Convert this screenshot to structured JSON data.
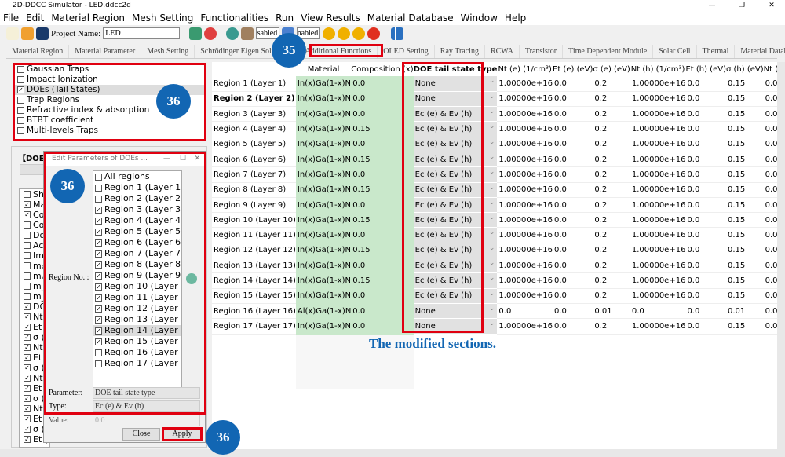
{
  "window": {
    "title": "2D-DDCC Simulator - LED.ddcc2d"
  },
  "menu": [
    "File",
    "Edit",
    "Material Region",
    "Mesh Setting",
    "Functionalities",
    "Run",
    "View Results",
    "Material Database",
    "Window",
    "Help"
  ],
  "toolbar": {
    "project_label": "Project Name:",
    "project_value": "LED",
    "combo1": "Disabled",
    "combo2": "Enabled"
  },
  "tabs": [
    "Material Region",
    "Material Parameter",
    "Mesh Setting",
    "Schrödinger Eigen Solver",
    "",
    "Additional Functions",
    "OLED Setting",
    "Ray Tracing",
    "RCWA",
    "Transistor",
    "Time Dependent Module",
    "Solar Cell",
    "Thermal",
    "Material Database"
  ],
  "active_tab": "Additional Functions",
  "function_list": [
    {
      "label": "Gaussian Traps",
      "checked": false
    },
    {
      "label": "Impact Ionization",
      "checked": false
    },
    {
      "label": "DOEs (Tail States)",
      "checked": true,
      "selected": true
    },
    {
      "label": "Trap Regions",
      "checked": false
    },
    {
      "label": "Refractive index & absorption",
      "checked": false
    },
    {
      "label": "BTBT coefficient",
      "checked": false
    },
    {
      "label": "Multi-levels Traps",
      "checked": false
    }
  ],
  "group_title": "【DOEs",
  "column_list": [
    {
      "l": "Sho",
      "c": false
    },
    {
      "l": "Ma",
      "c": true
    },
    {
      "l": "Cor",
      "c": true
    },
    {
      "l": "Cor",
      "c": false
    },
    {
      "l": "Dop",
      "c": false
    },
    {
      "l": "Act",
      "c": false
    },
    {
      "l": "Imp",
      "c": false
    },
    {
      "l": "mₑ",
      "c": false
    },
    {
      "l": "mₑ.",
      "c": false
    },
    {
      "l": "m_l",
      "c": false
    },
    {
      "l": "m_l",
      "c": false
    },
    {
      "l": "DO",
      "c": true
    },
    {
      "l": "Nt",
      "c": true
    },
    {
      "l": "Et (",
      "c": true
    },
    {
      "l": "σ (e",
      "c": true
    },
    {
      "l": "Nt",
      "c": true
    },
    {
      "l": "Et (",
      "c": true
    },
    {
      "l": "σ (h",
      "c": true
    },
    {
      "l": "Nt",
      "c": true
    },
    {
      "l": "Et (",
      "c": true
    },
    {
      "l": "σ (e",
      "c": true
    },
    {
      "l": "Nt",
      "c": true
    },
    {
      "l": "Et (",
      "c": true
    },
    {
      "l": "σ (h",
      "c": true
    },
    {
      "l": "Et (",
      "c": true
    }
  ],
  "dialog": {
    "title": "Edit Parameters of DOEs ...",
    "region_label": "Region No. :",
    "regions": [
      {
        "l": "All regions",
        "c": false
      },
      {
        "l": "Region 1 (Layer 1) (G",
        "c": false
      },
      {
        "l": "Region 2 (Layer 2) (G",
        "c": false
      },
      {
        "l": "Region 3 (Layer 3) (G",
        "c": true
      },
      {
        "l": "Region 4 (Layer 4) (In",
        "c": true
      },
      {
        "l": "Region 5 (Layer 5) (G",
        "c": true
      },
      {
        "l": "Region 6 (Layer 6) (In",
        "c": true
      },
      {
        "l": "Region 7 (Layer 7) (G",
        "c": true
      },
      {
        "l": "Region 8 (Layer 8) (In",
        "c": true
      },
      {
        "l": "Region 9 (Layer 9) (G",
        "c": true
      },
      {
        "l": "Region 10 (Layer 10)",
        "c": true
      },
      {
        "l": "Region 11 (Layer 11)",
        "c": true
      },
      {
        "l": "Region 12 (Layer 12)",
        "c": true
      },
      {
        "l": "Region 13 (Layer 13)",
        "c": true
      },
      {
        "l": "Region 14 (Layer 14)",
        "c": true,
        "sel": true
      },
      {
        "l": "Region 15 (Layer 15)",
        "c": true
      },
      {
        "l": "Region 16 (Layer 16)",
        "c": false
      },
      {
        "l": "Region 17 (Layer 17)",
        "c": false
      }
    ],
    "parameter_label": "Parameter:",
    "parameter_value": "DOE tail state type",
    "type_label": "Type:",
    "type_value": "Ec (e) & Ev (h)",
    "value_label": "Value:",
    "value_value": "0.0",
    "close": "Close",
    "apply": "Apply"
  },
  "table": {
    "headers": [
      "",
      "Material",
      "Composition (x)",
      "DOE tail state type",
      "Nt (e) (1/cm³)",
      "Et (e) (eV)",
      "σ (e) (eV)",
      "Nt (h) (1/cm³)",
      "Et (h) (eV)",
      "σ (h) (eV)",
      "Nt (e2) (1/"
    ],
    "rows": [
      [
        "Region 1 (Layer 1)",
        "In(x)Ga(1-x)N",
        "0.0",
        "None",
        "1.00000e+16",
        "0.0",
        "0.2",
        "1.00000e+16",
        "0.0",
        "0.15",
        "0.0"
      ],
      [
        "Region 2 (Layer 2)",
        "In(x)Ga(1-x)N",
        "0.0",
        "None",
        "1.00000e+16",
        "0.0",
        "0.2",
        "1.00000e+16",
        "0.0",
        "0.15",
        "0.0"
      ],
      [
        "Region 3 (Layer 3)",
        "In(x)Ga(1-x)N",
        "0.0",
        "Ec (e) & Ev (h)",
        "1.00000e+16",
        "0.0",
        "0.2",
        "1.00000e+16",
        "0.0",
        "0.15",
        "0.0"
      ],
      [
        "Region 4 (Layer 4)",
        "In(x)Ga(1-x)N",
        "0.15",
        "Ec (e) & Ev (h)",
        "1.00000e+16",
        "0.0",
        "0.2",
        "1.00000e+16",
        "0.0",
        "0.15",
        "0.0"
      ],
      [
        "Region 5 (Layer 5)",
        "In(x)Ga(1-x)N",
        "0.0",
        "Ec (e) & Ev (h)",
        "1.00000e+16",
        "0.0",
        "0.2",
        "1.00000e+16",
        "0.0",
        "0.15",
        "0.0"
      ],
      [
        "Region 6 (Layer 6)",
        "In(x)Ga(1-x)N",
        "0.15",
        "Ec (e) & Ev (h)",
        "1.00000e+16",
        "0.0",
        "0.2",
        "1.00000e+16",
        "0.0",
        "0.15",
        "0.0"
      ],
      [
        "Region 7 (Layer 7)",
        "In(x)Ga(1-x)N",
        "0.0",
        "Ec (e) & Ev (h)",
        "1.00000e+16",
        "0.0",
        "0.2",
        "1.00000e+16",
        "0.0",
        "0.15",
        "0.0"
      ],
      [
        "Region 8 (Layer 8)",
        "In(x)Ga(1-x)N",
        "0.15",
        "Ec (e) & Ev (h)",
        "1.00000e+16",
        "0.0",
        "0.2",
        "1.00000e+16",
        "0.0",
        "0.15",
        "0.0"
      ],
      [
        "Region 9 (Layer 9)",
        "In(x)Ga(1-x)N",
        "0.0",
        "Ec (e) & Ev (h)",
        "1.00000e+16",
        "0.0",
        "0.2",
        "1.00000e+16",
        "0.0",
        "0.15",
        "0.0"
      ],
      [
        "Region 10 (Layer 10)",
        "In(x)Ga(1-x)N",
        "0.15",
        "Ec (e) & Ev (h)",
        "1.00000e+16",
        "0.0",
        "0.2",
        "1.00000e+16",
        "0.0",
        "0.15",
        "0.0"
      ],
      [
        "Region 11 (Layer 11)",
        "In(x)Ga(1-x)N",
        "0.0",
        "Ec (e) & Ev (h)",
        "1.00000e+16",
        "0.0",
        "0.2",
        "1.00000e+16",
        "0.0",
        "0.15",
        "0.0"
      ],
      [
        "Region 12 (Layer 12)",
        "In(x)Ga(1-x)N",
        "0.15",
        "Ec (e) & Ev (h)",
        "1.00000e+16",
        "0.0",
        "0.2",
        "1.00000e+16",
        "0.0",
        "0.15",
        "0.0"
      ],
      [
        "Region 13 (Layer 13)",
        "In(x)Ga(1-x)N",
        "0.0",
        "Ec (e) & Ev (h)",
        "1.00000e+16",
        "0.0",
        "0.2",
        "1.00000e+16",
        "0.0",
        "0.15",
        "0.0"
      ],
      [
        "Region 14 (Layer 14)",
        "In(x)Ga(1-x)N",
        "0.15",
        "Ec (e) & Ev (h)",
        "1.00000e+16",
        "0.0",
        "0.2",
        "1.00000e+16",
        "0.0",
        "0.15",
        "0.0"
      ],
      [
        "Region 15 (Layer 15)",
        "In(x)Ga(1-x)N",
        "0.0",
        "Ec (e) & Ev (h)",
        "1.00000e+16",
        "0.0",
        "0.2",
        "1.00000e+16",
        "0.0",
        "0.15",
        "0.0"
      ],
      [
        "Region 16 (Layer 16)",
        "Al(x)Ga(1-x)N",
        "0.0",
        "None",
        "0.0",
        "0.0",
        "0.01",
        "0.0",
        "0.0",
        "0.01",
        "0.0"
      ],
      [
        "Region 17 (Layer 17)",
        "In(x)Ga(1-x)N",
        "0.0",
        "None",
        "1.00000e+16",
        "0.0",
        "0.2",
        "1.00000e+16",
        "0.0",
        "0.15",
        "0.0"
      ]
    ],
    "bold_row": 1
  },
  "annotations": {
    "step35": "35",
    "step36": "36",
    "note": "The modified sections."
  },
  "colors": {
    "accent_red": "#e00010",
    "badge_blue": "#1266b3",
    "material_green": "#c9e8cb"
  }
}
